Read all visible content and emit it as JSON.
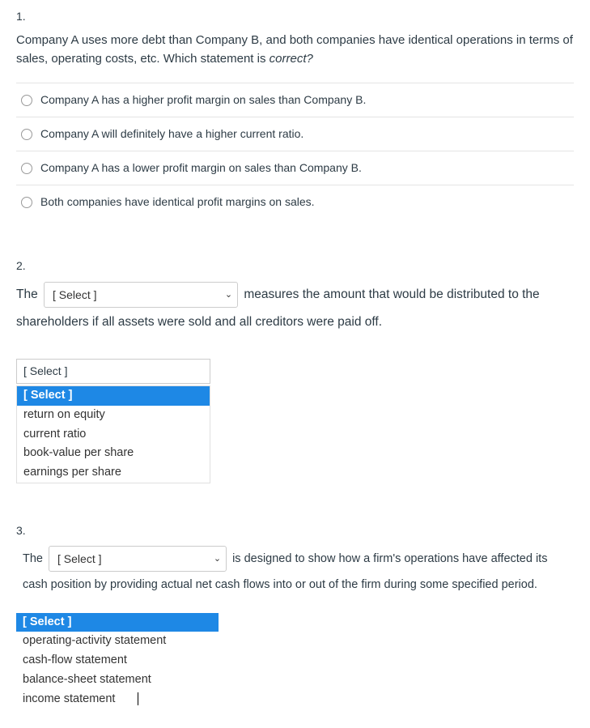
{
  "q1": {
    "number": "1.",
    "text_a": "Company A uses more debt than Company B, and both companies have identical operations in terms of sales, operating costs, etc. Which statement is ",
    "text_em": "correct?",
    "options": [
      "Company A has a higher profit margin on sales than Company B.",
      "Company A will definitely have a higher current ratio.",
      "Company A has a lower profit margin on sales than Company B.",
      "Both companies have identical profit margins on sales."
    ]
  },
  "q2": {
    "number": "2.",
    "pre": "The",
    "select_label": "[ Select ]",
    "post_a": "measures the amount that would be distributed to the",
    "post_b": "shareholders if all assets were sold and all creditors were paid off.",
    "dropdown": {
      "head": "[ Select ]",
      "items": [
        {
          "label": "[ Select ]",
          "highlight": true
        },
        {
          "label": "return on equity",
          "highlight": false
        },
        {
          "label": "current ratio",
          "highlight": false
        },
        {
          "label": "book-value per share",
          "highlight": false
        },
        {
          "label": "earnings per share",
          "highlight": false
        }
      ]
    }
  },
  "q3": {
    "number": "3.",
    "pre": "The",
    "select_label": "[ Select ]",
    "post_a": "is designed to show how a firm's operations have affected its",
    "post_b": "cash position by providing actual net cash flows into or out of the firm during some specified period.",
    "dropdown": {
      "items": [
        {
          "label": "[ Select ]",
          "highlight": true
        },
        {
          "label": "operating-activity statement",
          "highlight": false
        },
        {
          "label": "cash-flow statement",
          "highlight": false
        },
        {
          "label": "balance-sheet statement",
          "highlight": false
        },
        {
          "label": "income statement",
          "highlight": false
        }
      ]
    }
  }
}
